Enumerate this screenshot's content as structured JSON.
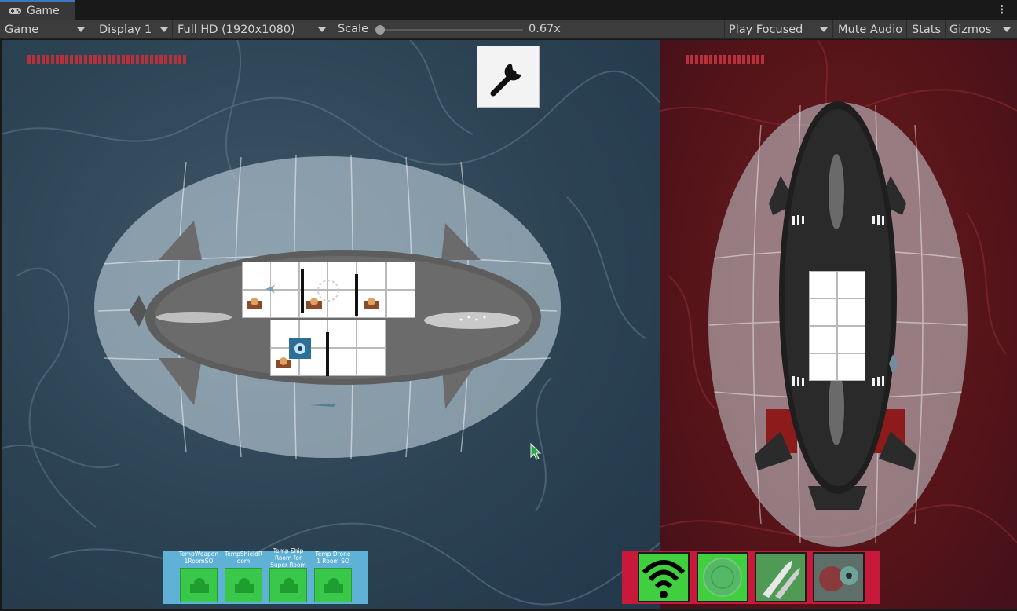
{
  "tab": {
    "label": "Game",
    "icon": "gamepad-icon"
  },
  "toolbar": {
    "view_mode": "Game",
    "display": "Display 1",
    "resolution": "Full HD (1920x1080)",
    "scale_label": "Scale",
    "scale_value": "0.67x",
    "play_mode": "Play Focused",
    "mute_audio": "Mute Audio",
    "stats": "Stats",
    "gizmos": "Gizmos"
  },
  "game": {
    "player_health_fraction": 1.0,
    "enemy_health_fraction": 1.0,
    "colors": {
      "player_bg": "#2c4354",
      "enemy_bg": "#551419",
      "health": "#b8303a",
      "palette_bg": "#5fb2d6",
      "slot_green": "#39c84a",
      "ability_bar": "#c8193a"
    },
    "wrench_button_icon": "wrench-icon",
    "room_palette": [
      {
        "label": "TempWeapon 1RoomSO",
        "icon": "turret-icon"
      },
      {
        "label": "TempShieldR oom",
        "icon": "turret-icon"
      },
      {
        "label": "Temp Ship Room for Super Room",
        "icon": "turret-icon"
      },
      {
        "label": "Temp Drone 1 Room SO",
        "icon": "turret-icon"
      }
    ],
    "abilities": [
      {
        "icon": "signal-icon"
      },
      {
        "icon": "shield-orb-icon"
      },
      {
        "icon": "missile-icon"
      },
      {
        "icon": "creature-icon"
      }
    ]
  }
}
